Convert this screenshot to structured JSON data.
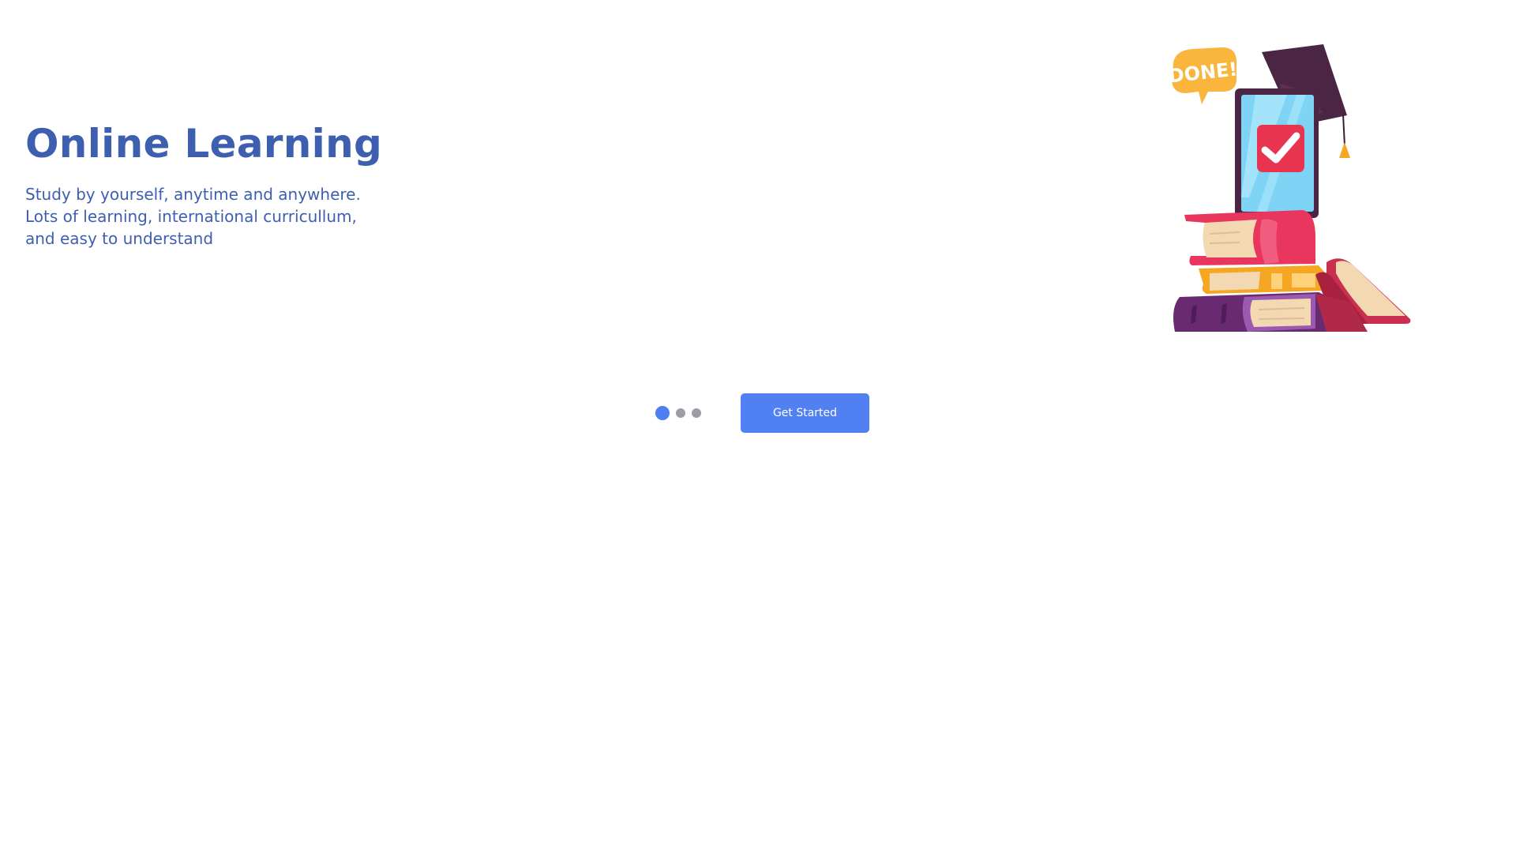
{
  "hero": {
    "title": "Online Learning",
    "subtitle_lines": [
      "Study by yourself, anytime and anywhere.",
      "Lots of learning, international curricullum,",
      "and easy to understand"
    ]
  },
  "illustration": {
    "bubble_text": "DONE!",
    "icon": "books-tablet-graduation-cap-illustration"
  },
  "pagination": {
    "total": 3,
    "active_index": 0
  },
  "cta": {
    "label": "Get Started"
  },
  "colors": {
    "title": "#3e5fb0",
    "accent": "#5180f2",
    "dot_inactive": "#9a9ea6"
  }
}
